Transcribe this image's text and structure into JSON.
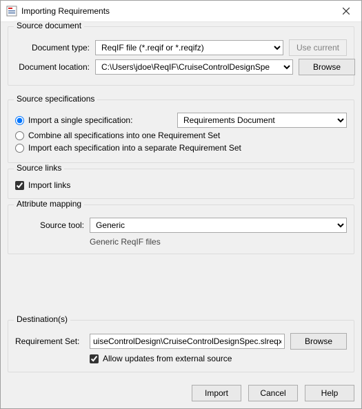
{
  "window": {
    "title": "Importing Requirements"
  },
  "groups": {
    "source_doc": {
      "legend": "Source document",
      "type_label": "Document type:",
      "type_value": "ReqIF file (*.reqif or *.reqifz)",
      "use_current": "Use current",
      "location_label": "Document location:",
      "location_value": "C:\\Users\\jdoe\\ReqIF\\CruiseControlDesignSpe",
      "browse": "Browse"
    },
    "source_spec": {
      "legend": "Source specifications",
      "opt_single": "Import a single specification:",
      "single_value": "Requirements Document",
      "opt_combine": "Combine all specifications into one Requirement Set",
      "opt_each": "Import each specification into a separate Requirement Set"
    },
    "source_links": {
      "legend": "Source links",
      "import_links": "Import links"
    },
    "attr_map": {
      "legend": "Attribute mapping",
      "tool_label": "Source tool:",
      "tool_value": "Generic",
      "tool_hint": "Generic ReqIF files"
    },
    "dest": {
      "legend": "Destination(s)",
      "set_label": "Requirement Set:",
      "set_value": "uiseControlDesign\\CruiseControlDesignSpec.slreqx",
      "browse": "Browse",
      "allow_updates": "Allow updates from external source"
    }
  },
  "footer": {
    "import": "Import",
    "cancel": "Cancel",
    "help": "Help"
  }
}
